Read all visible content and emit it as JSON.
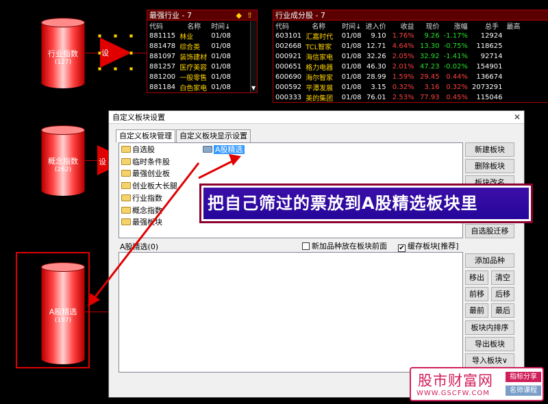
{
  "nodes": {
    "industry": {
      "label": "行业指数",
      "count": "(127)"
    },
    "concept": {
      "label": "概念指数",
      "count": "(262)"
    },
    "astock": {
      "label": "A股精选",
      "count": "(197)"
    },
    "tri1": "设",
    "tri2": "设"
  },
  "panel_left": {
    "title": "最强行业 - 7",
    "headers": [
      "代码",
      "名称",
      "时间↓"
    ],
    "rows": [
      {
        "code": "881115",
        "name": "林业",
        "time": "01/08"
      },
      {
        "code": "881478",
        "name": "综合类",
        "time": "01/08"
      },
      {
        "code": "881097",
        "name": "装饰建材",
        "time": "01/08"
      },
      {
        "code": "881257",
        "name": "医疗美容",
        "time": "01/08"
      },
      {
        "code": "881200",
        "name": "一般零售",
        "time": "01/08"
      },
      {
        "code": "881184",
        "name": "白色家电",
        "time": "01/08"
      }
    ]
  },
  "panel_right": {
    "title": "行业成分股 - 7",
    "headers": [
      "代码",
      "名称",
      "时间↓",
      "进入价",
      "收益",
      "现价",
      "涨幅",
      "总手",
      "最高"
    ],
    "rows": [
      {
        "code": "603101",
        "name": "汇嘉时代",
        "time": "01/08",
        "entry": "9.10",
        "gain": "1.76%",
        "price": "9.26",
        "chg": "-1.17%",
        "vol": "12924"
      },
      {
        "code": "002668",
        "name": "TCL智家",
        "time": "01/08",
        "entry": "12.71",
        "gain": "4.64%",
        "price": "13.30",
        "chg": "-0.75%",
        "vol": "118625"
      },
      {
        "code": "000921",
        "name": "海信家电",
        "time": "01/08",
        "entry": "32.26",
        "gain": "2.05%",
        "price": "32.92",
        "chg": "-1.41%",
        "vol": "92714"
      },
      {
        "code": "000651",
        "name": "格力电器",
        "time": "01/08",
        "entry": "46.30",
        "gain": "2.01%",
        "price": "47.23",
        "chg": "-0.02%",
        "vol": "154901"
      },
      {
        "code": "600690",
        "name": "海尔智家",
        "time": "01/08",
        "entry": "28.99",
        "gain": "1.59%",
        "price": "29.45",
        "chg": "0.44%",
        "vol": "136674"
      },
      {
        "code": "000592",
        "name": "平潭发展",
        "time": "01/08",
        "entry": "3.15",
        "gain": "0.32%",
        "price": "3.16",
        "chg": "0.32%",
        "vol": "2073291"
      },
      {
        "code": "000333",
        "name": "美的集团",
        "time": "01/08",
        "entry": "76.01",
        "gain": "2.53%",
        "price": "77.93",
        "chg": "0.45%",
        "vol": "115046"
      }
    ]
  },
  "dialog": {
    "title": "自定义板块设置",
    "close": "✕",
    "tabs": [
      "自定义板块管理",
      "自定义板块显示设置"
    ],
    "folders": [
      "自选股",
      "临时条件股",
      "最强创业板",
      "创业板大长腿",
      "行业指数",
      "概念指数",
      "最强板块"
    ],
    "selected_folder": "A股精选",
    "right_buttons_top": [
      "新建板块",
      "删除板块",
      "板块改名",
      "自选股迁移"
    ],
    "list_label": "A股精选(0)",
    "opt1": "新加品种放在板块前面",
    "opt2": "缓存板块[推荐]",
    "opt2_check": "✔",
    "btn_add": "添加品种",
    "btn_moveout": "移出",
    "btn_clear": "清空",
    "btn_front": "前移",
    "btn_back": "后移",
    "btn_first": "最前",
    "btn_last": "最后",
    "btn_sort": "板块内排序",
    "btn_export": "导出板块",
    "btn_import": "导入板块∨"
  },
  "callout": "把自己筛过的票放到A股精选板块里",
  "watermark": {
    "name": "股市财富网",
    "url": "WWW.GSCFW.COM",
    "tag1": "指标分享",
    "tag2": "名师课程"
  },
  "colors": {
    "accent_red": "#e00000",
    "callout_bg": "#2a0aa0",
    "gain_red": "#ff4040",
    "loss_green": "#28e028",
    "name_yellow": "#ffd400"
  }
}
